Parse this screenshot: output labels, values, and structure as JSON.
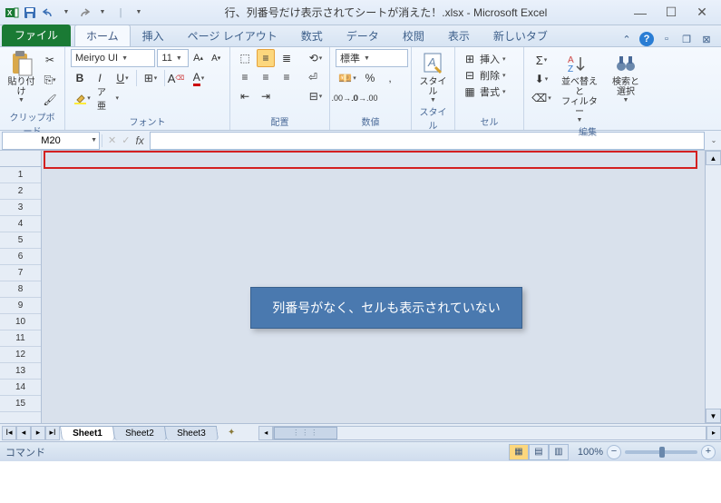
{
  "title": "行、列番号だけ表示されてシートが消えた！.xlsx - Microsoft Excel",
  "tabs": {
    "file": "ファイル",
    "items": [
      "ホーム",
      "挿入",
      "ページ レイアウト",
      "数式",
      "データ",
      "校閲",
      "表示",
      "新しいタブ"
    ],
    "active": 0
  },
  "ribbon": {
    "clipboard": {
      "title": "クリップボード",
      "paste": "貼り付け"
    },
    "font": {
      "title": "フォント",
      "name": "Meiryo UI",
      "size": "11",
      "bold": "B",
      "italic": "I",
      "underline": "U"
    },
    "alignment": {
      "title": "配置"
    },
    "number": {
      "title": "数値",
      "format": "標準"
    },
    "styles": {
      "title": "スタイル",
      "label": "スタイル"
    },
    "cells": {
      "title": "セル",
      "insert": "挿入",
      "delete": "削除",
      "format": "書式"
    },
    "editing": {
      "title": "編集",
      "sort": "並べ替えと\nフィルター",
      "find": "検索と\n選択"
    }
  },
  "namebox": "M20",
  "rows": [
    1,
    2,
    3,
    4,
    5,
    6,
    7,
    8,
    9,
    10,
    11,
    12,
    13,
    14,
    15
  ],
  "callout": "列番号がなく、セルも表示されていない",
  "sheets": [
    "Sheet1",
    "Sheet2",
    "Sheet3"
  ],
  "status": {
    "mode": "コマンド",
    "zoom": "100%"
  }
}
